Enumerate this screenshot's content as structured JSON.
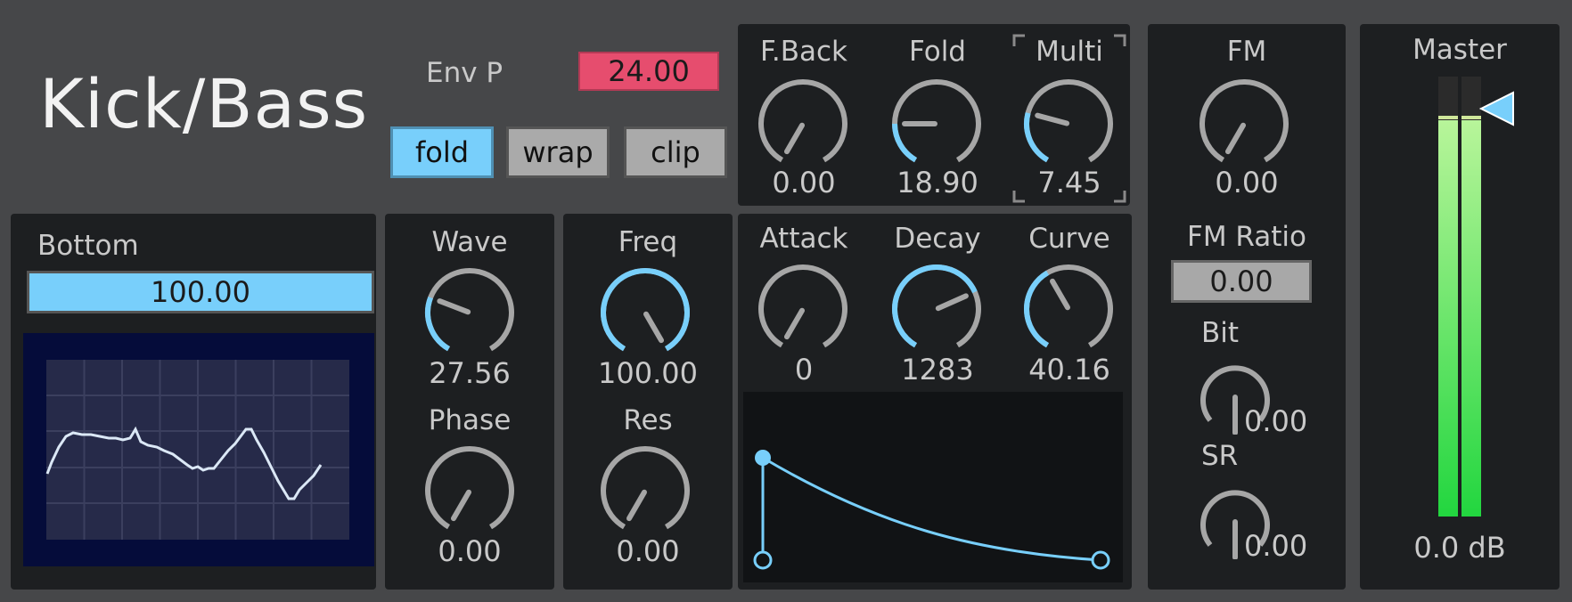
{
  "device_title": "Kick/Bass",
  "env_p": {
    "label": "Env P",
    "value": "24.00"
  },
  "mode_buttons": [
    {
      "label": "fold",
      "active": true
    },
    {
      "label": "wrap",
      "active": false
    },
    {
      "label": "clip",
      "active": false
    }
  ],
  "top_knobs": [
    {
      "label": "F.Back",
      "value": "0.00",
      "level": 0.0
    },
    {
      "label": "Fold",
      "value": "18.90",
      "level": 0.2
    },
    {
      "label": "Multi",
      "value": "7.45",
      "level": 0.25
    }
  ],
  "bottom": {
    "label": "Bottom",
    "value": "100.00"
  },
  "wave_knob": {
    "label": "Wave",
    "value": "27.56",
    "level": 0.27
  },
  "phase_knob": {
    "label": "Phase",
    "value": "0.00",
    "level": 0.0
  },
  "freq_knob": {
    "label": "Freq",
    "value": "100.00",
    "level": 1.0
  },
  "res_knob": {
    "label": "Res",
    "value": "0.00",
    "level": 0.0
  },
  "env_knobs": [
    {
      "label": "Attack",
      "value": "0",
      "level": 0.0
    },
    {
      "label": "Decay",
      "value": "1283",
      "level": 0.72
    },
    {
      "label": "Curve",
      "value": "40.16",
      "level": 0.4
    }
  ],
  "fm": {
    "label": "FM",
    "value": "0.00",
    "level": 0.0
  },
  "fm_ratio": {
    "label": "FM Ratio",
    "value": "0.00"
  },
  "bit": {
    "label": "Bit",
    "value": "0.00"
  },
  "sr": {
    "label": "SR",
    "value": "0.00"
  },
  "master": {
    "label": "Master",
    "value": "0.0 dB",
    "meter_level": 0.9
  },
  "colors": {
    "accent": "#78cffb",
    "env_p": "#e64d6e",
    "meter": "#3fe05a",
    "screen": "#050c3a"
  }
}
